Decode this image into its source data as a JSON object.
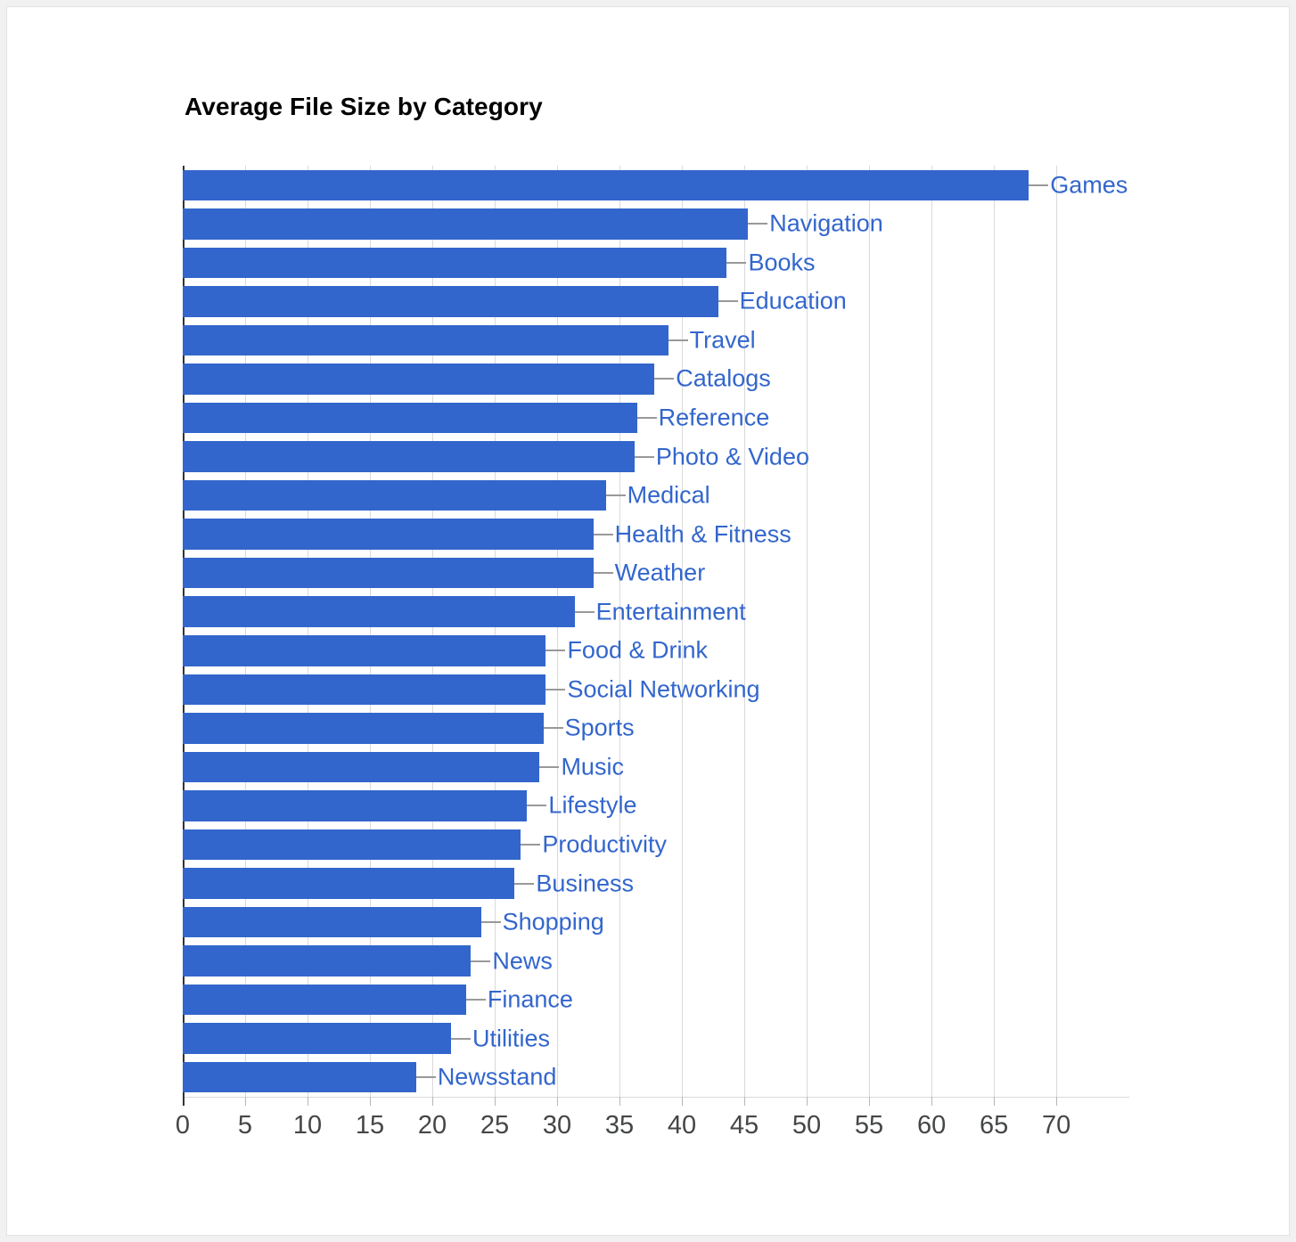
{
  "chart_data": {
    "type": "bar",
    "orientation": "horizontal",
    "title": "Average File Size by Category",
    "xlabel": "",
    "ylabel": "",
    "xlim": [
      0,
      75.85
    ],
    "xticks": [
      0,
      5,
      10,
      15,
      20,
      25,
      30,
      35,
      40,
      45,
      50,
      55,
      60,
      65,
      70
    ],
    "xtick_labels": [
      "0",
      "5",
      "10",
      "15",
      "20",
      "25",
      "30",
      "35",
      "40",
      "45",
      "50",
      "55",
      "60",
      "65",
      "70"
    ],
    "grid": true,
    "grid_axis": "x",
    "legend": false,
    "bar_color": "#3366cc",
    "label_color": "#3366cc",
    "leader_color": "#999999",
    "title_color": "#000000",
    "axis_color": "#333333",
    "gridline_color": "#d9d9d9",
    "tick_label_color": "#444746",
    "categories": [
      "Games",
      "Navigation",
      "Books",
      "Education",
      "Travel",
      "Catalogs",
      "Reference",
      "Photo & Video",
      "Medical",
      "Health & Fitness",
      "Weather",
      "Entertainment",
      "Food & Drink",
      "Social Networking",
      "Sports",
      "Music",
      "Lifestyle",
      "Productivity",
      "Business",
      "Shopping",
      "News",
      "Finance",
      "Utilities",
      "Newsstand"
    ],
    "values": [
      67.8,
      45.3,
      43.6,
      42.9,
      38.9,
      37.8,
      36.4,
      36.2,
      33.9,
      32.9,
      32.9,
      31.4,
      29.1,
      29.1,
      28.9,
      28.6,
      27.6,
      27.1,
      26.6,
      23.9,
      23.1,
      22.7,
      21.5,
      18.7
    ]
  }
}
